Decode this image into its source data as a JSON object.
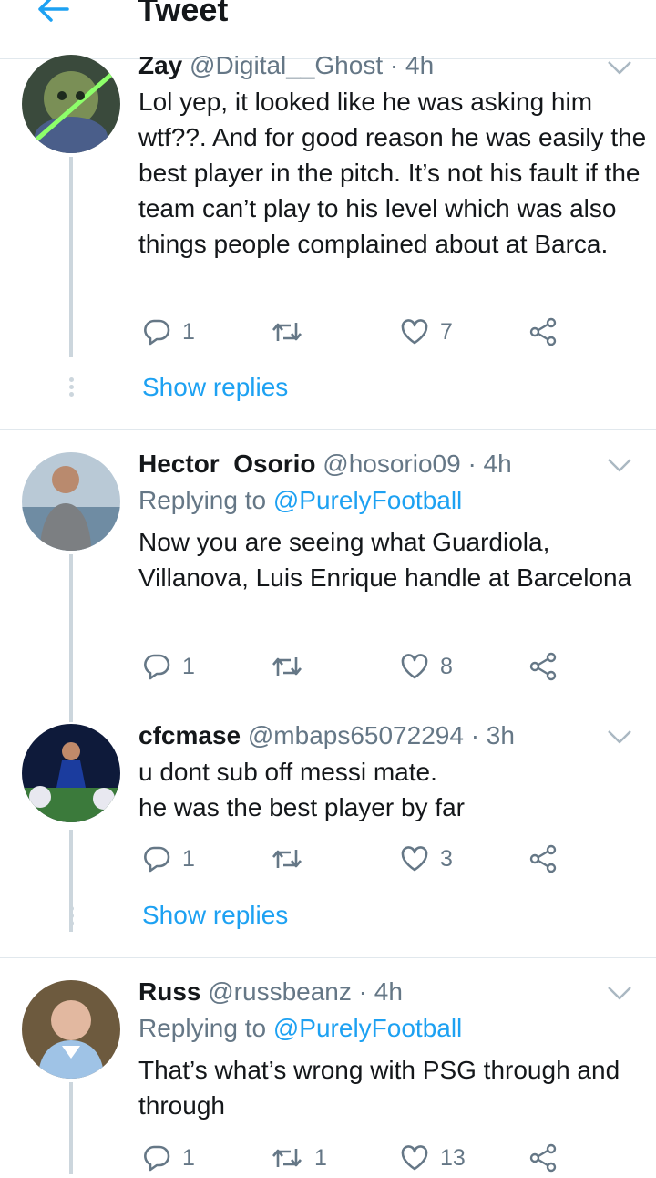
{
  "header": {
    "title": "Tweet"
  },
  "tweets": [
    {
      "name": "Zay",
      "handle": "@Digital__Ghost",
      "time": "· 4h",
      "replying_label": "",
      "replying_to": "",
      "text": "Lol yep, it looked like he was asking him wtf??. And for good reason he was easily the best player in the pitch. It’s not his fault if the team can’t play to his level which was also things people complained about at Barca.",
      "replies": "1",
      "retweets": "",
      "likes": "7",
      "show_replies": "Show replies"
    },
    {
      "name": "Hector  Osorio",
      "handle": "@hosorio09",
      "time": "· 4h",
      "replying_label": "Replying to",
      "replying_to": "@PurelyFootball",
      "text": "Now you are seeing what Guardiola, Villanova, Luis Enrique handle at Barcelona",
      "replies": "1",
      "retweets": "",
      "likes": "8",
      "show_replies": ""
    },
    {
      "name": "cfcmase",
      "handle": "@mbaps65072294",
      "time": "· 3h",
      "replying_label": "",
      "replying_to": "",
      "text": "u dont sub off messi mate.\nhe was the best player by far",
      "replies": "1",
      "retweets": "",
      "likes": "3",
      "show_replies": "Show replies"
    },
    {
      "name": "Russ",
      "handle": "@russbeanz",
      "time": "· 4h",
      "replying_label": "Replying to",
      "replying_to": "@PurelyFootball",
      "text": "That’s what’s wrong with PSG through and through",
      "replies": "1",
      "retweets": "1",
      "likes": "13",
      "show_replies": ""
    }
  ],
  "icons": {
    "back": "back-arrow-icon",
    "reply": "reply-icon",
    "retweet": "retweet-icon",
    "like": "heart-icon",
    "share": "share-icon",
    "more": "chevron-down-icon"
  },
  "colors": {
    "accent": "#1da1f2",
    "muted": "#657786",
    "line": "#ccd6dd",
    "text": "#14171a"
  }
}
